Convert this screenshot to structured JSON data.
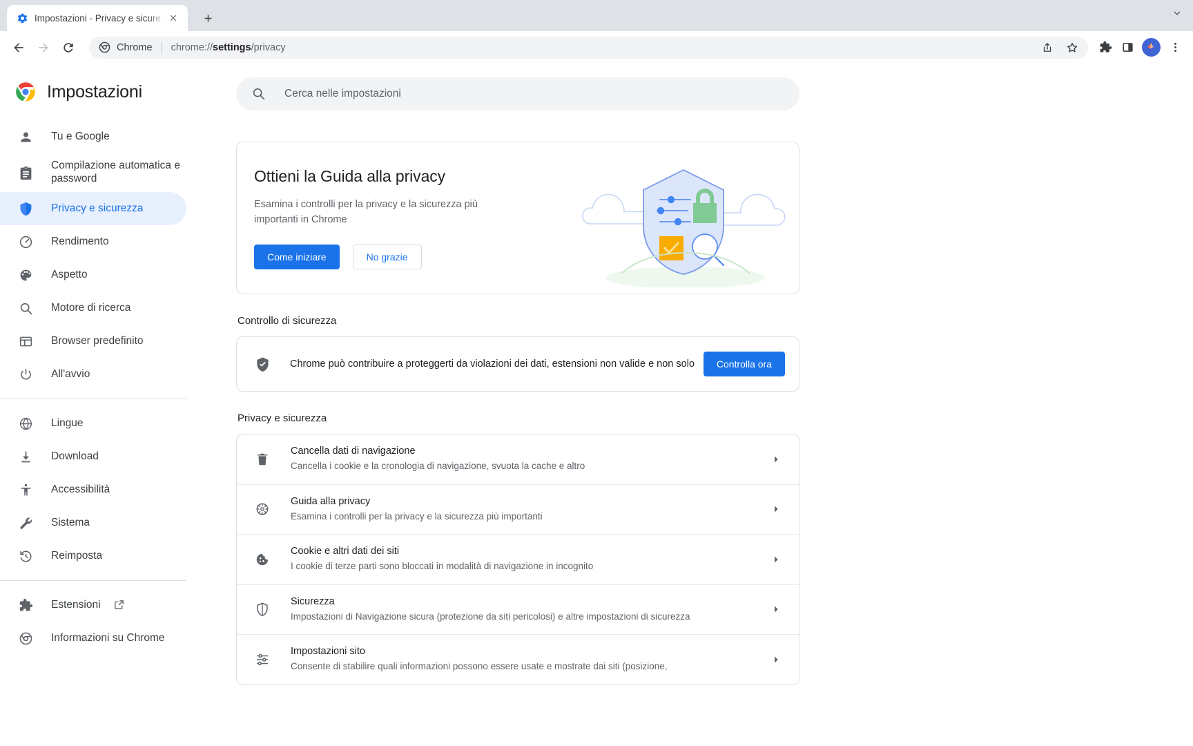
{
  "window": {
    "tab": {
      "title": "Impostazioni - Privacy e sicure",
      "favicon": "settings-gear-icon",
      "close": "close-icon"
    },
    "new_tab_label": "+",
    "chevron": "chevron-down-icon"
  },
  "toolbar": {
    "back": "back-arrow-icon",
    "forward": "forward-arrow-icon",
    "reload": "reload-icon",
    "omnibox": {
      "site_icon": "chrome-icon",
      "site_label": "Chrome",
      "url_prefix": "chrome://",
      "url_bold": "settings",
      "url_suffix": "/privacy"
    },
    "actions": [
      "share-icon",
      "star-icon"
    ],
    "right_icons": [
      "extensions-puzzle-icon",
      "side-panel-icon"
    ],
    "avatar": "profile-avatar",
    "menu": "three-dot-menu-icon"
  },
  "sidebar": {
    "brand": "Impostazioni",
    "brand_icon": "chrome-logo-icon",
    "groups": [
      {
        "items": [
          {
            "label": "Tu e Google",
            "icon": "person-icon",
            "active": false
          },
          {
            "label": "Compilazione automatica e password",
            "icon": "clipboard-icon",
            "active": false,
            "two_line": true
          },
          {
            "label": "Privacy e sicurezza",
            "icon": "shield-icon",
            "active": true
          },
          {
            "label": "Rendimento",
            "icon": "speedometer-icon",
            "active": false
          },
          {
            "label": "Aspetto",
            "icon": "palette-icon",
            "active": false
          },
          {
            "label": "Motore di ricerca",
            "icon": "search-icon",
            "active": false
          },
          {
            "label": "Browser predefinito",
            "icon": "browser-window-icon",
            "active": false
          },
          {
            "label": "All'avvio",
            "icon": "power-icon",
            "active": false
          }
        ]
      },
      {
        "items": [
          {
            "label": "Lingue",
            "icon": "globe-icon",
            "active": false
          },
          {
            "label": "Download",
            "icon": "download-icon",
            "active": false
          },
          {
            "label": "Accessibilità",
            "icon": "accessibility-icon",
            "active": false
          },
          {
            "label": "Sistema",
            "icon": "wrench-icon",
            "active": false
          },
          {
            "label": "Reimposta",
            "icon": "history-restore-icon",
            "active": false
          }
        ]
      },
      {
        "items": [
          {
            "label": "Estensioni",
            "icon": "puzzle-icon",
            "active": false,
            "external": "external-link-icon"
          },
          {
            "label": "Informazioni su Chrome",
            "icon": "chrome-circle-icon",
            "active": false
          }
        ]
      }
    ]
  },
  "search": {
    "icon": "search-icon",
    "placeholder": "Cerca nelle impostazioni",
    "value": ""
  },
  "promo": {
    "title": "Ottieni la Guida alla privacy",
    "description": "Esamina i controlli per la privacy e la sicurezza più importanti in Chrome",
    "primary_button": "Come iniziare",
    "secondary_button": "No grazie",
    "illustration": "privacy-shield-illustration"
  },
  "safety_check": {
    "heading": "Controllo di sicurezza",
    "icon": "shield-check-icon",
    "text": "Chrome può contribuire a proteggerti da violazioni dei dati, estensioni non valide e non solo",
    "button": "Controlla ora"
  },
  "privacy_section": {
    "heading": "Privacy e sicurezza",
    "rows": [
      {
        "icon": "trash-icon",
        "title": "Cancella dati di navigazione",
        "subtitle": "Cancella i cookie e la cronologia di navigazione, svuota la cache e altro",
        "arrow": "chevron-right-icon"
      },
      {
        "icon": "privacy-guide-icon",
        "title": "Guida alla privacy",
        "subtitle": "Esamina i controlli per la privacy e la sicurezza più importanti",
        "arrow": "chevron-right-icon"
      },
      {
        "icon": "cookie-icon",
        "title": "Cookie e altri dati dei siti",
        "subtitle": "I cookie di terze parti sono bloccati in modalità di navigazione in incognito",
        "arrow": "chevron-right-icon"
      },
      {
        "icon": "shield-icon",
        "title": "Sicurezza",
        "subtitle": "Impostazioni di Navigazione sicura (protezione da siti pericolosi) e altre impostazioni di sicurezza",
        "arrow": "chevron-right-icon"
      },
      {
        "icon": "sliders-icon",
        "title": "Impostazioni sito",
        "subtitle": "Consente di stabilire quali informazioni possono essere usate e mostrate dai siti (posizione,",
        "arrow": "chevron-right-icon"
      }
    ]
  },
  "colors": {
    "accent": "#1a73e8",
    "active_bg": "#e8f0fe",
    "tabstrip": "#dee1e6",
    "omnibox_bg": "#f1f3f4",
    "text_primary": "#202124",
    "text_secondary": "#5f6368",
    "border": "#e0e0e0"
  }
}
